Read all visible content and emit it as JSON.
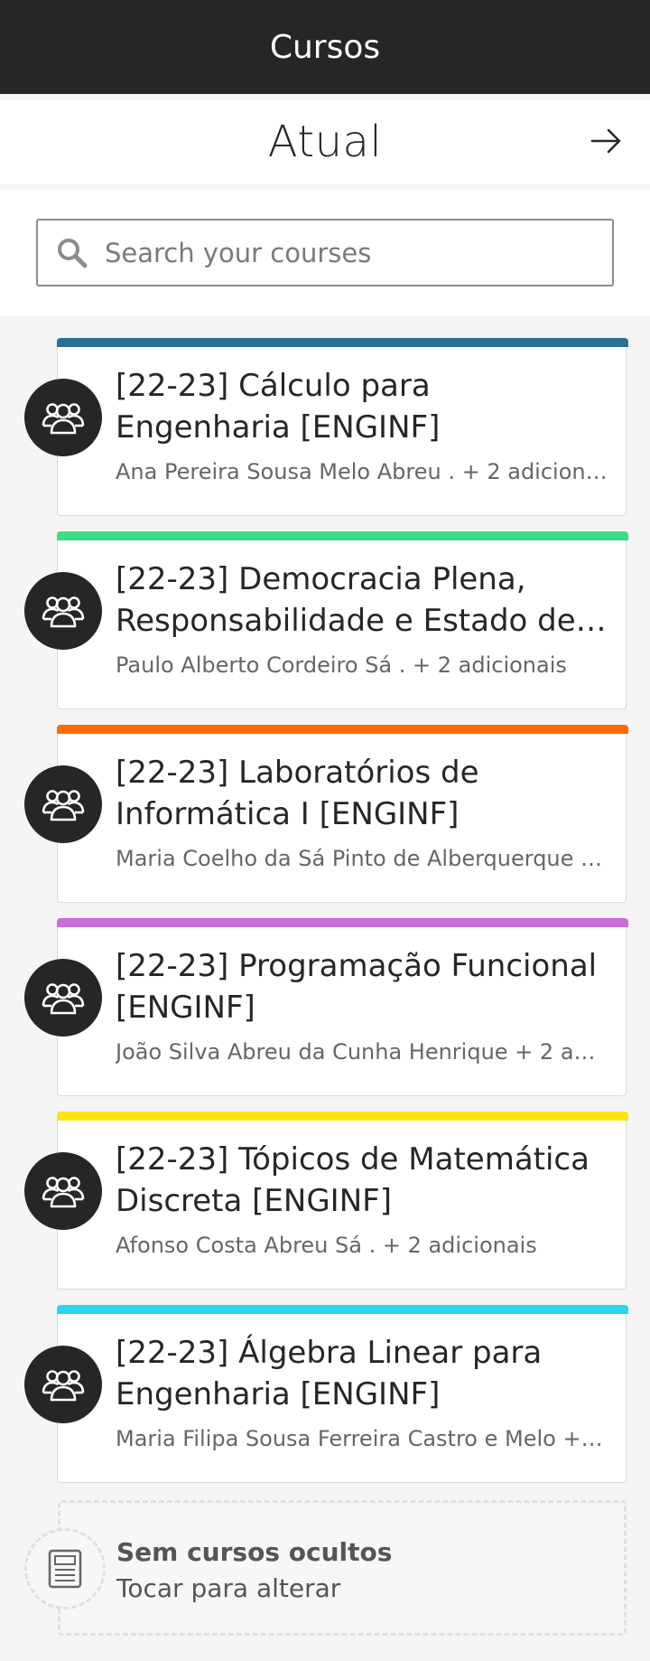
{
  "app_bar": {
    "title": "Cursos"
  },
  "term": {
    "title": "Atual",
    "next_icon": "arrow-right-icon"
  },
  "search": {
    "placeholder": "Search your courses",
    "value": ""
  },
  "courses": [
    {
      "title": "[22-23] Cálculo para Engenharia [ENGINF]",
      "teachers": "Ana Pereira Sousa Melo Abreu . + 2 adicionais ....",
      "color": "#2a6f97",
      "icon": "group-icon"
    },
    {
      "title": "[22-23] Democracia Plena, Responsabilidade e Estado de ...",
      "teachers": "Paulo Alberto Cordeiro Sá . + 2 adicionais",
      "color": "#3ddc84",
      "icon": "group-icon"
    },
    {
      "title": "[22-23] Laboratórios de Informática I [ENGINF]",
      "teachers": " Maria Coelho da Sá Pinto de Alberquerque . ....",
      "color": "#ff6a00",
      "icon": "group-icon"
    },
    {
      "title": "[22-23] Programação Funcional [ENGINF]",
      "teachers": "João Silva Abreu da Cunha Henrique + 2 adic ....",
      "color": "#c86dd7",
      "icon": "group-icon"
    },
    {
      "title": "[22-23] Tópicos de Matemática Discreta [ENGINF]",
      "teachers": "Afonso Costa Abreu Sá . + 2 adicionais",
      "color": "#ffe310",
      "icon": "group-icon"
    },
    {
      "title": "[22-23] Álgebra Linear para Engenharia [ENGINF]",
      "teachers": "Maria Filipa Sousa Ferreira Castro e Melo + 1 ....",
      "color": "#2bd4f5",
      "icon": "group-icon"
    }
  ],
  "hidden_courses": {
    "title": "Sem cursos ocultos",
    "subtitle": "Tocar para alterar",
    "icon": "archive-icon"
  }
}
